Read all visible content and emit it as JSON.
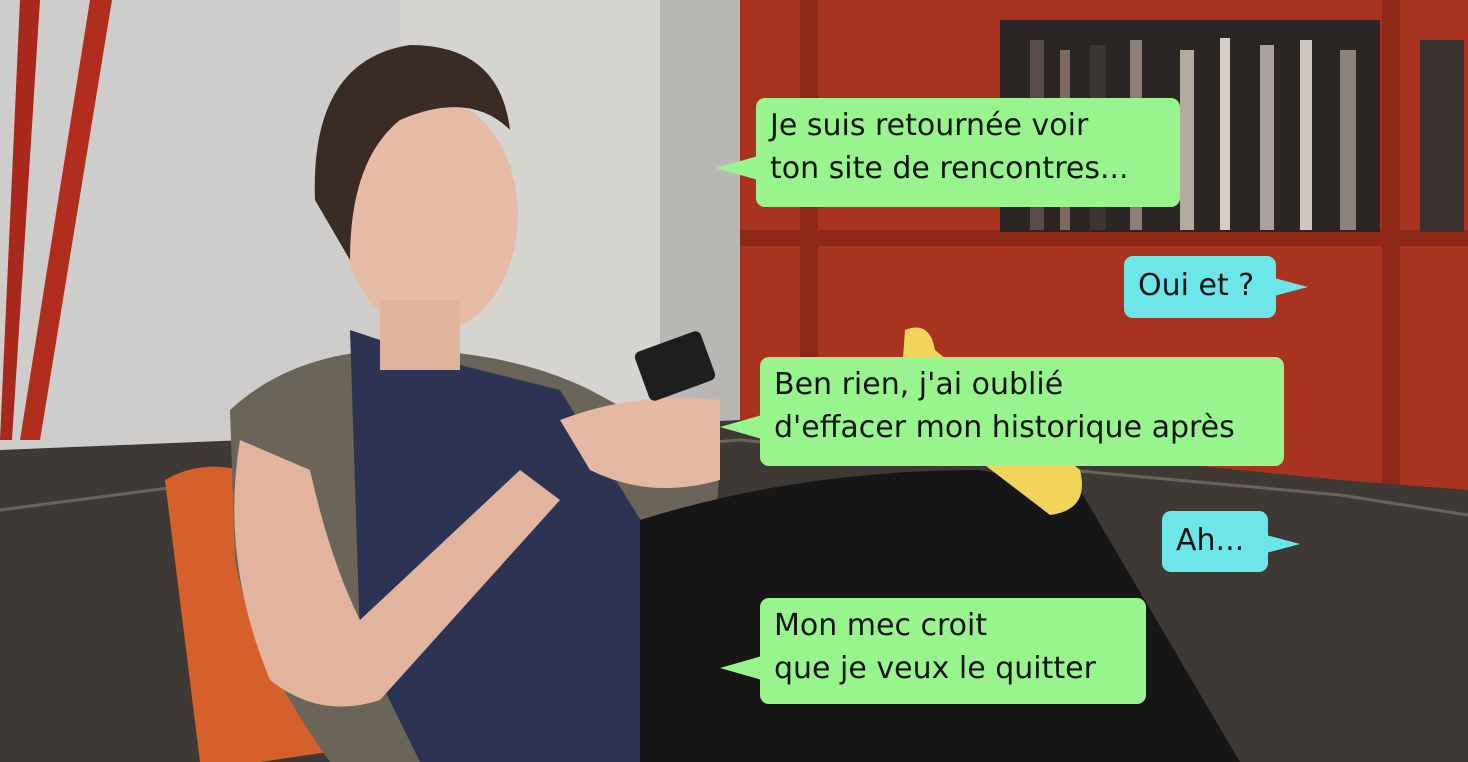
{
  "conversation": {
    "messages": [
      {
        "side": "incoming",
        "lines": [
          "Je suis retournée voir",
          "ton site de rencontres..."
        ]
      },
      {
        "side": "outgoing",
        "lines": [
          "Oui et ?"
        ]
      },
      {
        "side": "incoming",
        "lines": [
          "Ben rien, j'ai oublié",
          "d'effacer mon historique après"
        ]
      },
      {
        "side": "outgoing",
        "lines": [
          "Ah..."
        ]
      },
      {
        "side": "incoming",
        "lines": [
          "Mon mec croit",
          "que je veux le quitter"
        ]
      }
    ]
  },
  "colors": {
    "incoming_bubble": "#98f58e",
    "outgoing_bubble": "#6ce6e8",
    "text": "#141414",
    "wall": "#cfcdcb",
    "shelf_red": "#a8331f",
    "sofa": "#3f3935",
    "cushion": "#d6602a"
  }
}
